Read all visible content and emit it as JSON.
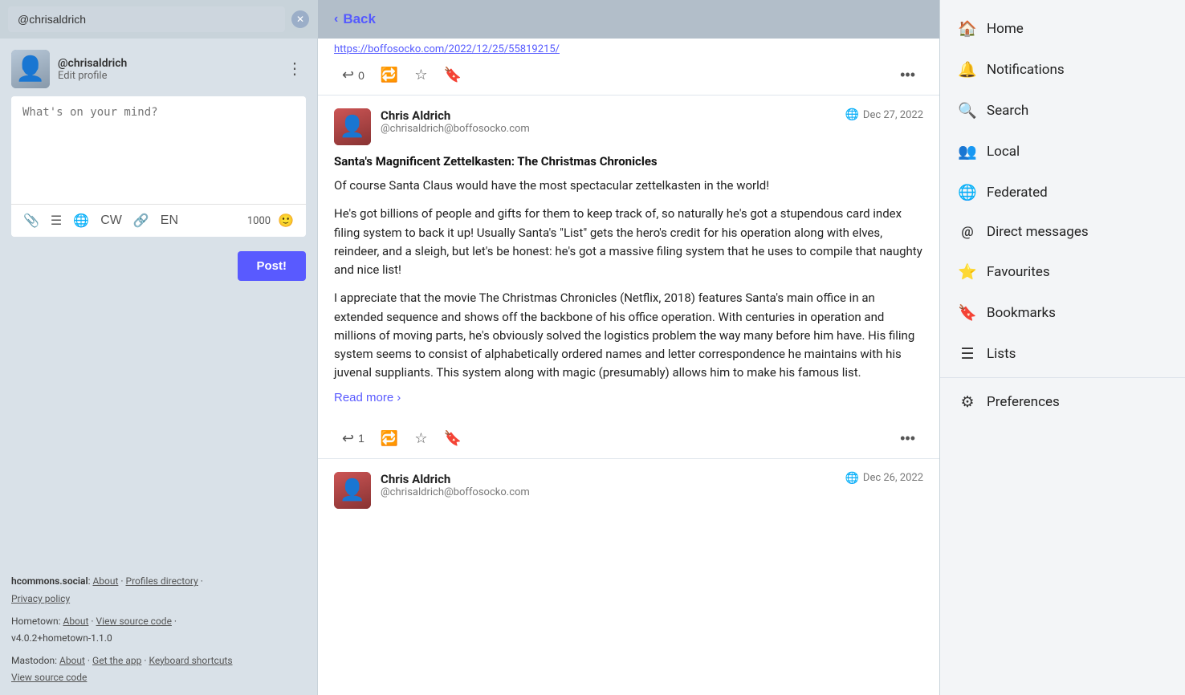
{
  "left": {
    "search_value": "@chrisaldrich",
    "profile": {
      "name": "@chrisaldrich",
      "edit_label": "Edit profile"
    },
    "compose": {
      "placeholder": "What's on your mind?",
      "char_count": "1000"
    },
    "toolbar": {
      "attachment_icon": "📎",
      "list_icon": "☰",
      "globe_icon": "🌐",
      "cw_label": "CW",
      "link_icon": "🔗",
      "lang_label": "EN",
      "emoji_icon": "🙂"
    },
    "post_button_label": "Post!",
    "footer": {
      "hcommons_label": "hcommons.social",
      "about_link": "About",
      "profiles_dir_link": "Profiles directory",
      "privacy_link": "Privacy policy",
      "hometown_label": "Hometown",
      "hometown_about": "About",
      "hometown_source": "View source code",
      "hometown_version": "v4.0.2+hometown-1.1.0",
      "mastodon_label": "Mastodon",
      "mastodon_about": "About",
      "mastodon_app": "Get the app",
      "mastodon_keyboard": "Keyboard shortcuts",
      "mastodon_source": "View source code"
    }
  },
  "middle": {
    "back_label": "Back",
    "post_url": "https://boffosocko.com/2022/12/25/55819215/",
    "first_post": {
      "reply_count": "0",
      "date": "Dec 27, 2022",
      "author_name": "Chris Aldrich",
      "author_handle": "@chrisaldrich@boffosocko.com",
      "title": "Santa's Magnificent Zettelkasten: The Christmas Chronicles",
      "body_p1": "Of course Santa Claus would have the most spectacular zettelkasten in the world!",
      "body_p2": "He's got billions of people and gifts for them to keep track of, so naturally he's got a stupendous card index filing system to back it up! Usually Santa's \"List\" gets the hero's credit for his operation along with elves, reindeer, and a sleigh, but let's be honest: he's got a massive filing system that he uses to compile that naughty and nice list!",
      "body_p3": "I appreciate that the movie The Christmas Chronicles (Netflix, 2018) features Santa's main office in an extended sequence and shows off the backbone of his office operation. With centuries in operation and millions of moving parts, he's obviously solved the logistics problem the way many before him have. His filing system seems to consist of alphabetically ordered names and letter correspondence he maintains with his juvenal suppliants. This system along with magic (presumably) allows him to make his famous list.",
      "read_more": "Read more",
      "reply_count2": "1"
    },
    "second_post": {
      "date": "Dec 26, 2022",
      "author_name": "Chris Aldrich",
      "author_handle": "@chrisaldrich@boffosocko.com"
    }
  },
  "right": {
    "nav_items": [
      {
        "id": "home",
        "icon": "🏠",
        "label": "Home"
      },
      {
        "id": "notifications",
        "icon": "🔔",
        "label": "Notifications"
      },
      {
        "id": "search",
        "icon": "🔍",
        "label": "Search"
      },
      {
        "id": "local",
        "icon": "👥",
        "label": "Local"
      },
      {
        "id": "federated",
        "icon": "🌐",
        "label": "Federated"
      },
      {
        "id": "direct-messages",
        "icon": "@",
        "label": "Direct messages"
      },
      {
        "id": "favourites",
        "icon": "⭐",
        "label": "Favourites"
      },
      {
        "id": "bookmarks",
        "icon": "🔖",
        "label": "Bookmarks"
      },
      {
        "id": "lists",
        "icon": "☰",
        "label": "Lists"
      },
      {
        "id": "preferences",
        "icon": "⚙",
        "label": "Preferences"
      }
    ]
  }
}
